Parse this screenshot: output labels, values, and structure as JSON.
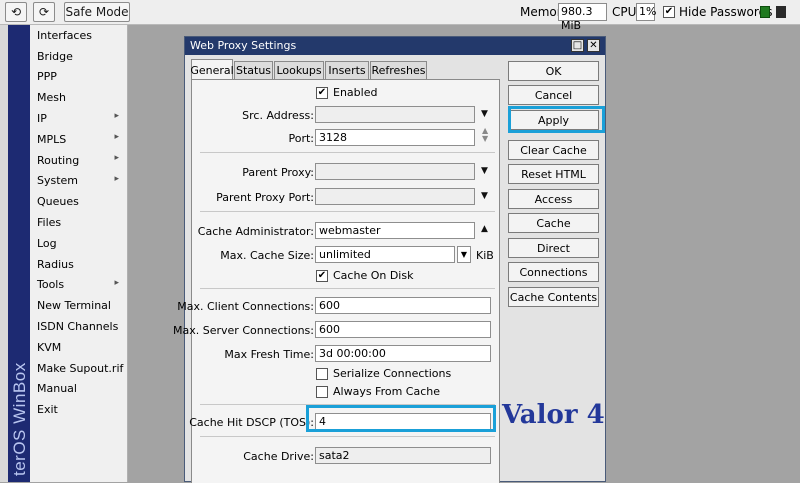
{
  "toolbar": {
    "undo_icon": "undo-icon",
    "redo_icon": "redo-icon",
    "safe_mode": "Safe Mode",
    "memory_label": "Memory:",
    "memory_value": "980.3 MiB",
    "cpu_label": "CPU:",
    "cpu_value": "1%",
    "hide_passwords": "Hide Passwords",
    "hide_passwords_checked": true
  },
  "sidebar": {
    "brand": "terOS WinBox",
    "items": [
      {
        "label": "Interfaces",
        "submenu": false
      },
      {
        "label": "Bridge",
        "submenu": false
      },
      {
        "label": "PPP",
        "submenu": false
      },
      {
        "label": "Mesh",
        "submenu": false
      },
      {
        "label": "IP",
        "submenu": true
      },
      {
        "label": "MPLS",
        "submenu": true
      },
      {
        "label": "Routing",
        "submenu": true
      },
      {
        "label": "System",
        "submenu": true
      },
      {
        "label": "Queues",
        "submenu": false
      },
      {
        "label": "Files",
        "submenu": false
      },
      {
        "label": "Log",
        "submenu": false
      },
      {
        "label": "Radius",
        "submenu": false
      },
      {
        "label": "Tools",
        "submenu": true
      },
      {
        "label": "New Terminal",
        "submenu": false
      },
      {
        "label": "ISDN Channels",
        "submenu": false
      },
      {
        "label": "KVM",
        "submenu": false
      },
      {
        "label": "Make Supout.rif",
        "submenu": false
      },
      {
        "label": "Manual",
        "submenu": false
      },
      {
        "label": "Exit",
        "submenu": false
      }
    ]
  },
  "window": {
    "title": "Web Proxy Settings",
    "tabs": [
      "General",
      "Status",
      "Lookups",
      "Inserts",
      "Refreshes"
    ],
    "active_tab": "General",
    "form": {
      "enabled_label": "Enabled",
      "src_address_label": "Src. Address:",
      "src_address_value": "",
      "port_label": "Port:",
      "port_value": "3128",
      "parent_proxy_label": "Parent Proxy:",
      "parent_proxy_value": "",
      "parent_proxy_port_label": "Parent Proxy Port:",
      "parent_proxy_port_value": "",
      "cache_admin_label": "Cache Administrator:",
      "cache_admin_value": "webmaster",
      "max_cache_size_label": "Max. Cache Size:",
      "max_cache_size_value": "unlimited",
      "max_cache_size_unit": "KiB",
      "cache_on_disk_label": "Cache On Disk",
      "max_client_conn_label": "Max. Client Connections:",
      "max_client_conn_value": "600",
      "max_server_conn_label": "Max. Server Connections:",
      "max_server_conn_value": "600",
      "max_fresh_time_label": "Max Fresh Time:",
      "max_fresh_time_value": "3d 00:00:00",
      "serialize_conn_label": "Serialize Connections",
      "always_from_cache_label": "Always From Cache",
      "cache_hit_dscp_label": "Cache Hit DSCP (TOS):",
      "cache_hit_dscp_value": "4",
      "cache_drive_label": "Cache Drive:",
      "cache_drive_value": "sata2"
    },
    "buttons": [
      "OK",
      "Cancel",
      "Apply",
      "Clear Cache",
      "Reset HTML",
      "Access",
      "Cache",
      "Direct",
      "Connections",
      "Cache Contents"
    ]
  },
  "annotation": {
    "text": "Valor 4",
    "highlight_color": "#1aa0d8",
    "text_color": "#23389a"
  }
}
